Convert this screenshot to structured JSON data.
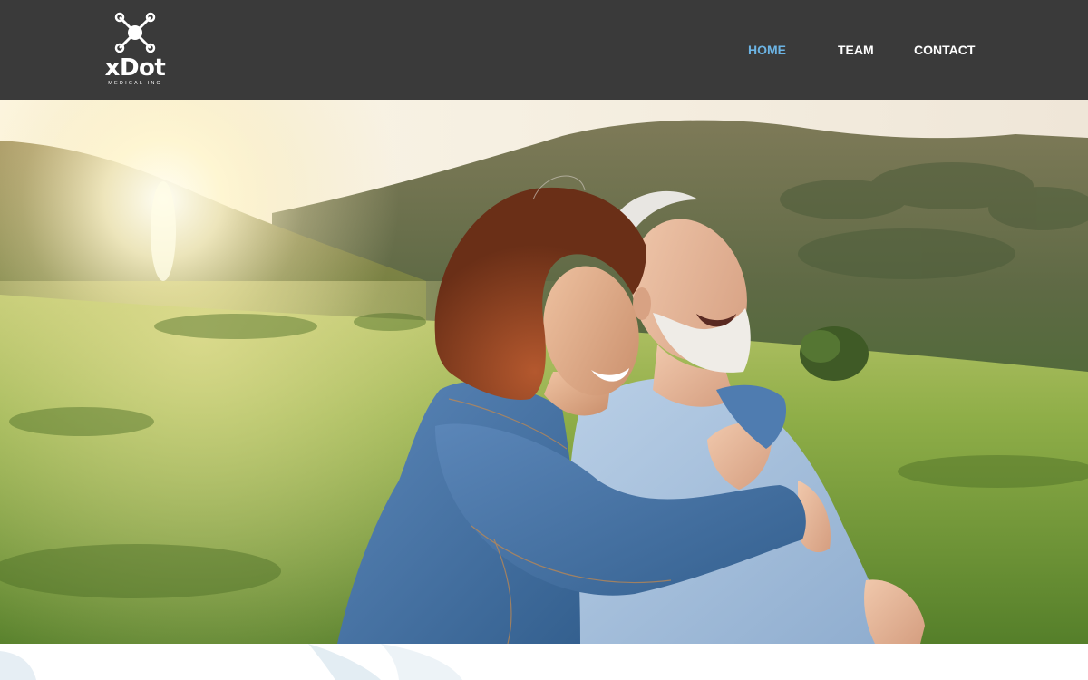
{
  "brand": {
    "name": "xDot",
    "tagline": "MEDICAL INC",
    "logo_icon": "drone-x-icon",
    "color": "#ffffff"
  },
  "nav": {
    "items": [
      {
        "label": "HOME",
        "active": true
      },
      {
        "label": "TEAM",
        "active": false
      },
      {
        "label": "CONTACT",
        "active": false
      }
    ],
    "active_color": "#6cb4e4",
    "text_color": "#ffffff"
  },
  "header": {
    "background": "#3a3a3a"
  },
  "hero": {
    "image": "photo-senior-couple-embracing-in-sunny-meadow"
  }
}
